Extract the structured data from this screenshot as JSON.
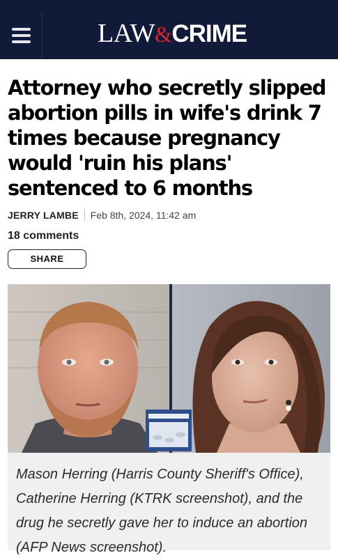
{
  "header": {
    "menu_icon": "hamburger-menu-icon",
    "logo": {
      "part1": "LAW",
      "amp": "&",
      "part2": "CRIME",
      "accent_color": "#d9262e"
    },
    "background": "#111a38"
  },
  "article": {
    "headline": "Attorney who secretly slipped abortion pills in wife's drink 7 times because pregnancy would 'ruin his plans' sentenced to 6 months",
    "author": "JERRY LAMBE",
    "date": "Feb 8th, 2024, 11:42 am",
    "comments": "18 comments",
    "share_label": "SHARE",
    "image": {
      "subjects": [
        "man-mugshot",
        "woman-interview"
      ],
      "inset_icon": "pill-pack-icon"
    },
    "caption": "Mason Herring (Harris County Sheriff's Office), Catherine Herring (KTRK screenshot), and the drug he secretly gave her to induce an abortion (AFP News screenshot)."
  }
}
